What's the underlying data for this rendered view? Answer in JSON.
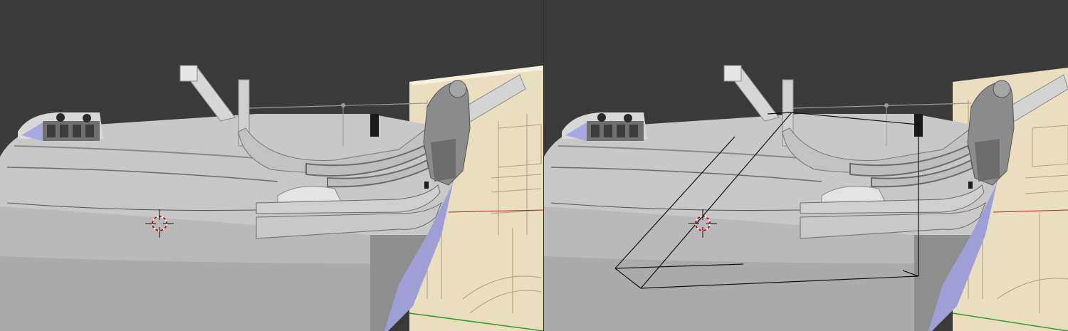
{
  "viewports": [
    {
      "name": "viewport-left",
      "overlay": false
    },
    {
      "name": "viewport-right",
      "overlay": true
    }
  ],
  "colors": {
    "background": "#3a3a3a",
    "hull": "#c8c8c8",
    "hull_shadow": "#9a9a9a",
    "hull_dark": "#7a7a7a",
    "hull_highlight": "#e0e0e0",
    "under_hull": "#9e9fd6",
    "blueprint": "#e9dfbf",
    "x_axis": "#b02020",
    "y_axis": "#2f9a2f",
    "cursor_red": "#d00000",
    "wire": "#111111"
  },
  "icons": {
    "cursor": "3d-cursor-icon"
  }
}
